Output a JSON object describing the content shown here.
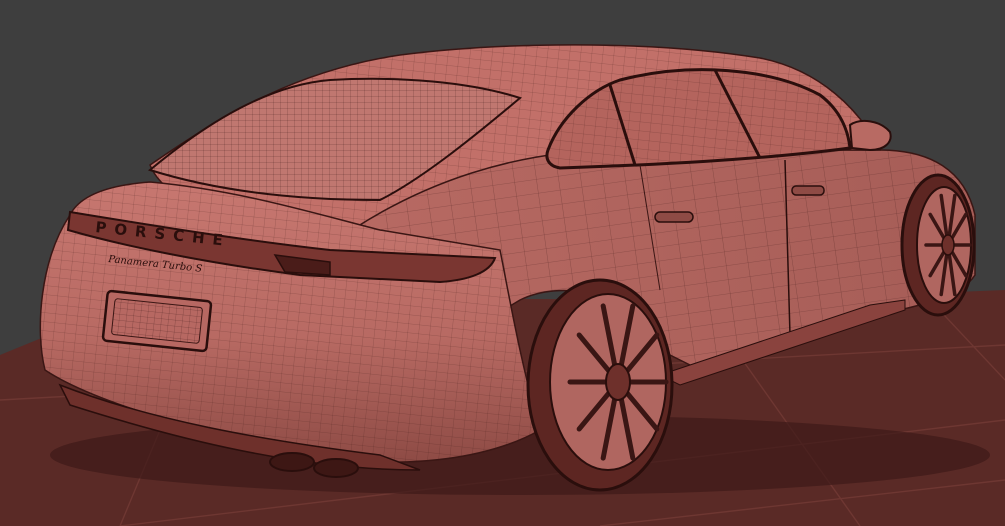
{
  "viewport": {
    "background_color": "#3e3e3e",
    "ground_color": "#5a2a26",
    "grid_line_color": "#6e3732"
  },
  "model": {
    "body_color": "#b86a63",
    "body_shadow_color": "#8e4b45",
    "wire_color": "#3a1614",
    "rear_brand_text": "PORSCHE",
    "model_badge_text": "Panamera Turbo S"
  }
}
